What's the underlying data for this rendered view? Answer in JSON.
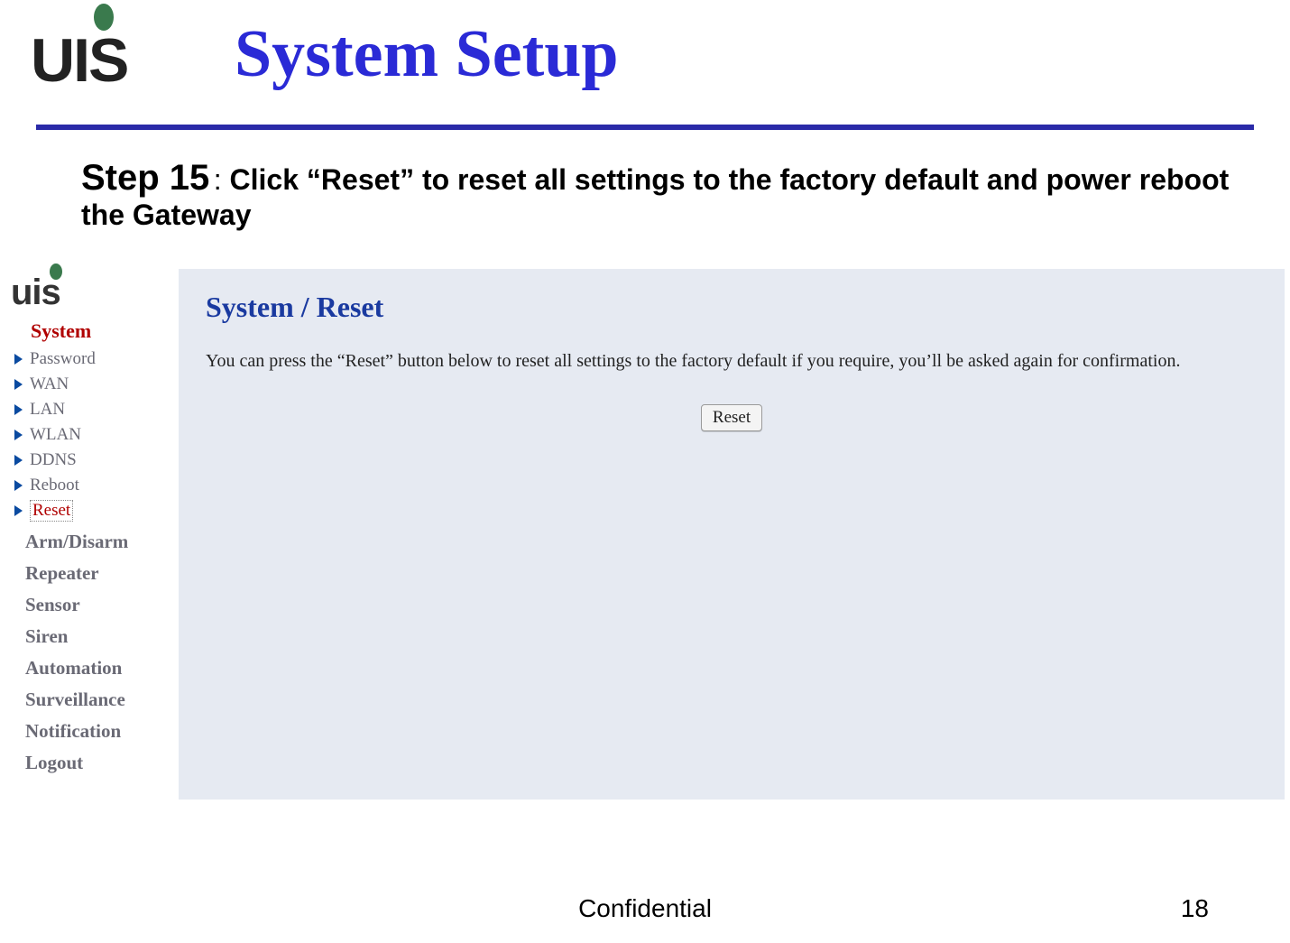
{
  "header": {
    "logo_text": "UIS",
    "title": "System Setup"
  },
  "step": {
    "label": "Step 15",
    "separator": " : ",
    "body": "Click “Reset” to reset all settings to the factory default and power reboot the Gateway"
  },
  "sidebar": {
    "logo_text": "uis",
    "active_heading": "System",
    "items": [
      {
        "label": "Password",
        "active": false
      },
      {
        "label": "WAN",
        "active": false
      },
      {
        "label": "LAN",
        "active": false
      },
      {
        "label": "WLAN",
        "active": false
      },
      {
        "label": "DDNS",
        "active": false
      },
      {
        "label": "Reboot",
        "active": false
      },
      {
        "label": "Reset",
        "active": true
      }
    ],
    "sections": [
      "Arm/Disarm",
      "Repeater",
      "Sensor",
      "Siren",
      "Automation",
      "Surveillance",
      "Notification",
      "Logout"
    ]
  },
  "panel": {
    "title": "System / Reset",
    "description": "You can press the “Reset” button below to reset all settings to the factory default if you require, you’ll be asked again for confirmation.",
    "button_label": "Reset"
  },
  "footer": {
    "confidential": "Confidential",
    "page": "18"
  }
}
